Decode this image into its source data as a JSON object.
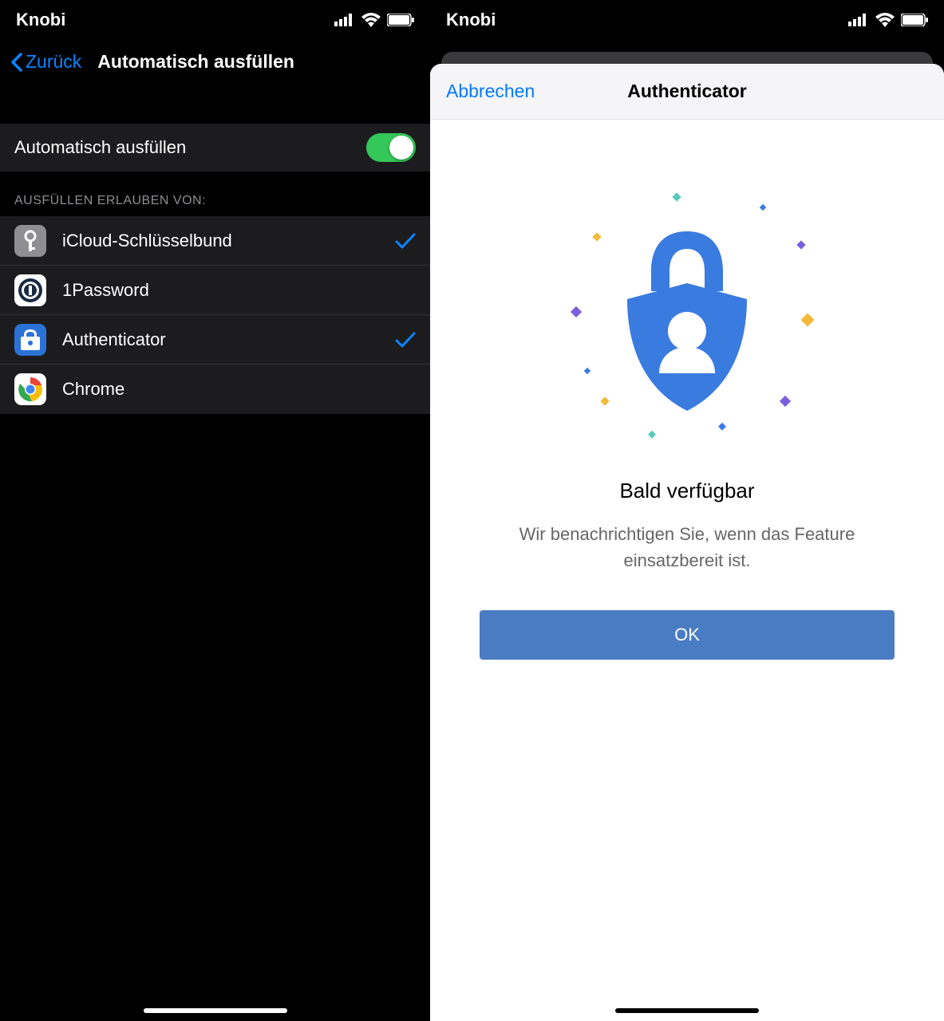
{
  "left": {
    "status": {
      "carrier": "Knobi"
    },
    "nav": {
      "back": "Zurück",
      "title": "Automatisch ausfüllen"
    },
    "autofill_row_label": "Automatisch ausfüllen",
    "section_header": "AUSFÜLLEN ERLAUBEN VON:",
    "providers": [
      {
        "label": "iCloud-Schlüsselbund",
        "checked": true
      },
      {
        "label": "1Password",
        "checked": false
      },
      {
        "label": "Authenticator",
        "checked": true
      },
      {
        "label": "Chrome",
        "checked": false
      }
    ]
  },
  "right": {
    "status": {
      "carrier": "Knobi"
    },
    "sheet": {
      "cancel": "Abbrechen",
      "title": "Authenticator",
      "body_title": "Bald verfügbar",
      "body_text": "Wir benachrichtigen Sie, wenn das Feature einsatzbereit ist.",
      "ok": "OK"
    }
  },
  "colors": {
    "blue_ios": "#0a84ff",
    "green_toggle": "#34c759",
    "btn_blue": "#4a7cc4",
    "shield_blue": "#3a7be0"
  }
}
